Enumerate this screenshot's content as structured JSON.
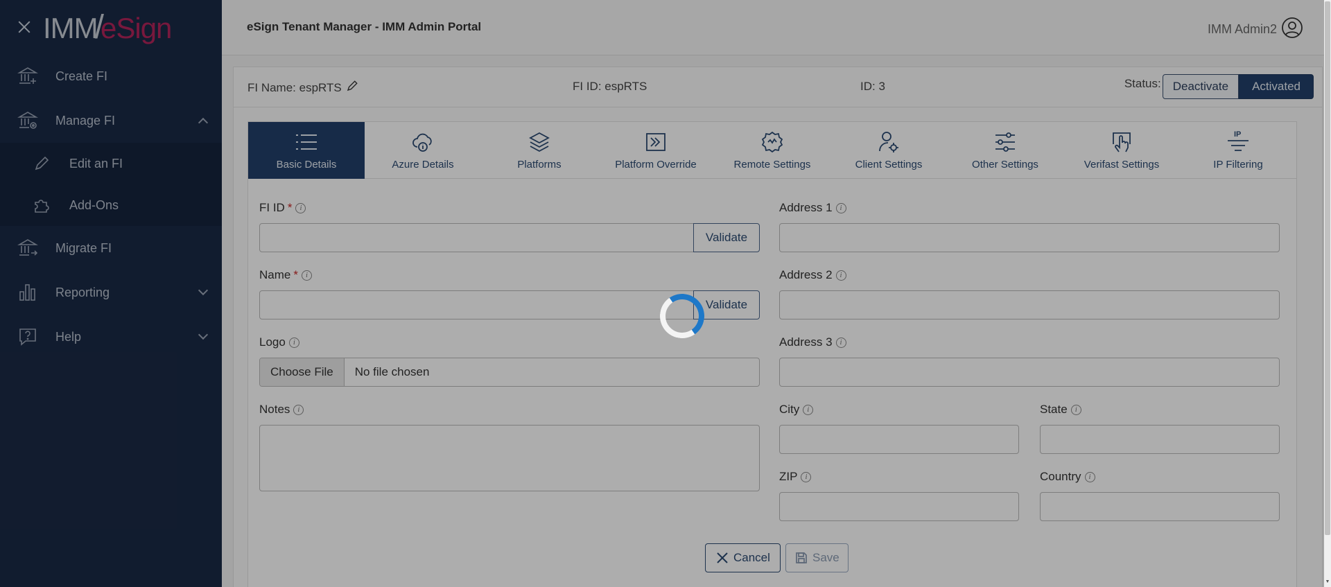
{
  "sidebar": {
    "logo_imm": "IMM",
    "logo_esign": "eSign",
    "items": [
      {
        "label": "Create FI",
        "icon": "bank-plus-icon"
      },
      {
        "label": "Manage FI",
        "icon": "bank-gear-icon"
      },
      {
        "label": "Migrate FI",
        "icon": "bank-arrow-icon"
      },
      {
        "label": "Reporting",
        "icon": "bar-chart-icon"
      },
      {
        "label": "Help",
        "icon": "help-bubble-icon"
      }
    ],
    "sub_items": [
      {
        "label": "Edit an FI",
        "icon": "pencil-icon"
      },
      {
        "label": "Add-Ons",
        "icon": "puzzle-icon"
      }
    ]
  },
  "header": {
    "title": "eSign Tenant Manager - IMM Admin Portal",
    "user": "IMM Admin2"
  },
  "info": {
    "fi_name": "FI Name: espRTS",
    "fi_id": "FI ID: espRTS",
    "id": "ID: 3",
    "status_label": "Status:",
    "deactivate": "Deactivate",
    "activated": "Activated"
  },
  "tabs": [
    {
      "label": "Basic Details",
      "icon": "list-icon"
    },
    {
      "label": "Azure Details",
      "icon": "cloud-info-icon"
    },
    {
      "label": "Platforms",
      "icon": "layers-icon"
    },
    {
      "label": "Platform Override",
      "icon": "override-arrow-icon"
    },
    {
      "label": "Remote Settings",
      "icon": "remote-gear-icon"
    },
    {
      "label": "Client Settings",
      "icon": "user-gear-icon"
    },
    {
      "label": "Other Settings",
      "icon": "sliders-icon"
    },
    {
      "label": "Verifast Settings",
      "icon": "hand-touch-icon"
    },
    {
      "label": "IP Filtering",
      "icon": "ip-filter-icon"
    }
  ],
  "form": {
    "fi_id_label": "FI ID",
    "name_label": "Name",
    "required_mark": "*",
    "validate": "Validate",
    "logo_label": "Logo",
    "choose_file": "Choose File",
    "no_file": "No file chosen",
    "notes_label": "Notes",
    "address1_label": "Address 1",
    "address2_label": "Address 2",
    "address3_label": "Address 3",
    "city_label": "City",
    "state_label": "State",
    "zip_label": "ZIP",
    "country_label": "Country",
    "cancel": "Cancel",
    "save": "Save"
  },
  "colors": {
    "sidebar_bg": "#1a2a46",
    "accent": "#22406a",
    "brand_esign": "#b2245a",
    "spinner": "#1e78c8"
  }
}
